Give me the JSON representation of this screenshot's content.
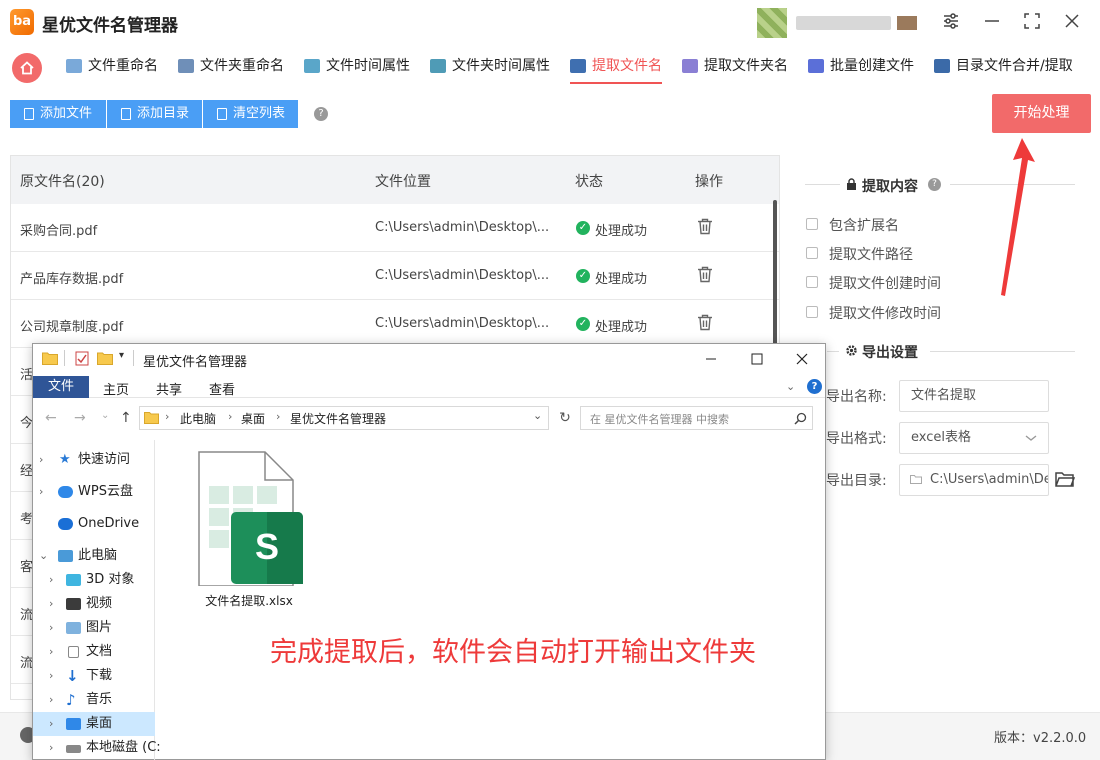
{
  "app": {
    "logo_text": "ba",
    "title": "星优文件名管理器",
    "window_buttons": [
      "settings-sliders-icon",
      "minimize-icon",
      "maximize-icon",
      "close-icon"
    ]
  },
  "tabs": [
    {
      "label": "文件重命名",
      "icon": "file-rename-icon",
      "active": false
    },
    {
      "label": "文件夹重命名",
      "icon": "folder-rename-icon",
      "active": false
    },
    {
      "label": "文件时间属性",
      "icon": "file-time-icon",
      "active": false
    },
    {
      "label": "文件夹时间属性",
      "icon": "folder-time-icon",
      "active": false
    },
    {
      "label": "提取文件名",
      "icon": "extract-filename-icon",
      "active": true
    },
    {
      "label": "提取文件夹名",
      "icon": "extract-foldername-icon",
      "active": false
    },
    {
      "label": "批量创建文件",
      "icon": "batch-create-icon",
      "active": false
    },
    {
      "label": "目录文件合并/提取",
      "icon": "directory-merge-icon",
      "active": false
    }
  ],
  "toolbar": {
    "add_file": "添加文件",
    "add_dir": "添加目录",
    "clear_list": "清空列表",
    "help": "?",
    "start": "开始处理"
  },
  "table": {
    "headers": [
      "原文件名(20)",
      "文件位置",
      "状态",
      "操作"
    ],
    "rows": [
      {
        "name": "采购合同.pdf",
        "path": "C:\\Users\\admin\\Desktop\\...",
        "status": "处理成功"
      },
      {
        "name": "产品库存数据.pdf",
        "path": "C:\\Users\\admin\\Desktop\\...",
        "status": "处理成功"
      },
      {
        "name": "公司规章制度.pdf",
        "path": "C:\\Users\\admin\\Desktop\\...",
        "status": "处理成功"
      }
    ],
    "partial_rows": [
      "活",
      "今",
      "经",
      "考",
      "客",
      "流",
      "流"
    ]
  },
  "right_panel": {
    "extract_title": "提取内容",
    "options": [
      "包含扩展名",
      "提取文件路径",
      "提取文件创建时间",
      "提取文件修改时间"
    ],
    "export_title": "导出设置",
    "export_name_label": "导出名称:",
    "export_name_value": "文件名提取",
    "export_format_label": "导出格式:",
    "export_format_value": "excel表格",
    "export_dir_label": "导出目录:",
    "export_dir_value": "C:\\Users\\admin\\Des"
  },
  "status_bar": {
    "version": "版本：v2.2.0.0"
  },
  "explorer": {
    "title": "星优文件名管理器",
    "ribbon_tabs": [
      "文件",
      "主页",
      "共享",
      "查看"
    ],
    "breadcrumb": [
      "此电脑",
      "桌面",
      "星优文件名管理器"
    ],
    "search_placeholder": "在 星优文件名管理器 中搜索",
    "tree": [
      {
        "label": "快速访问",
        "icon": "star-icon",
        "indent": 0
      },
      {
        "label": "WPS云盘",
        "icon": "cloud-icon",
        "indent": 0
      },
      {
        "label": "OneDrive",
        "icon": "onedrive-icon",
        "indent": 0
      },
      {
        "label": "此电脑",
        "icon": "computer-icon",
        "indent": 0,
        "expanded": true
      },
      {
        "label": "3D 对象",
        "icon": "3d-objects-icon",
        "indent": 1
      },
      {
        "label": "视频",
        "icon": "video-icon",
        "indent": 1
      },
      {
        "label": "图片",
        "icon": "pictures-icon",
        "indent": 1
      },
      {
        "label": "文档",
        "icon": "documents-icon",
        "indent": 1
      },
      {
        "label": "下载",
        "icon": "download-icon",
        "indent": 1
      },
      {
        "label": "音乐",
        "icon": "music-icon",
        "indent": 1
      },
      {
        "label": "桌面",
        "icon": "desktop-icon",
        "indent": 1,
        "selected": true
      },
      {
        "label": "本地磁盘 (C:",
        "icon": "disk-icon",
        "indent": 1
      }
    ],
    "file_name": "文件名提取.xlsx",
    "file_badge": "S"
  },
  "overlay_message": "完成提取后，软件会自动打开输出文件夹",
  "colors": {
    "accent_red": "#f26a6a",
    "primary_blue": "#4a9ef5",
    "success_green": "#22b35e",
    "annotation_red": "#ee3a3a",
    "excel_green": "#1d8f5a"
  }
}
